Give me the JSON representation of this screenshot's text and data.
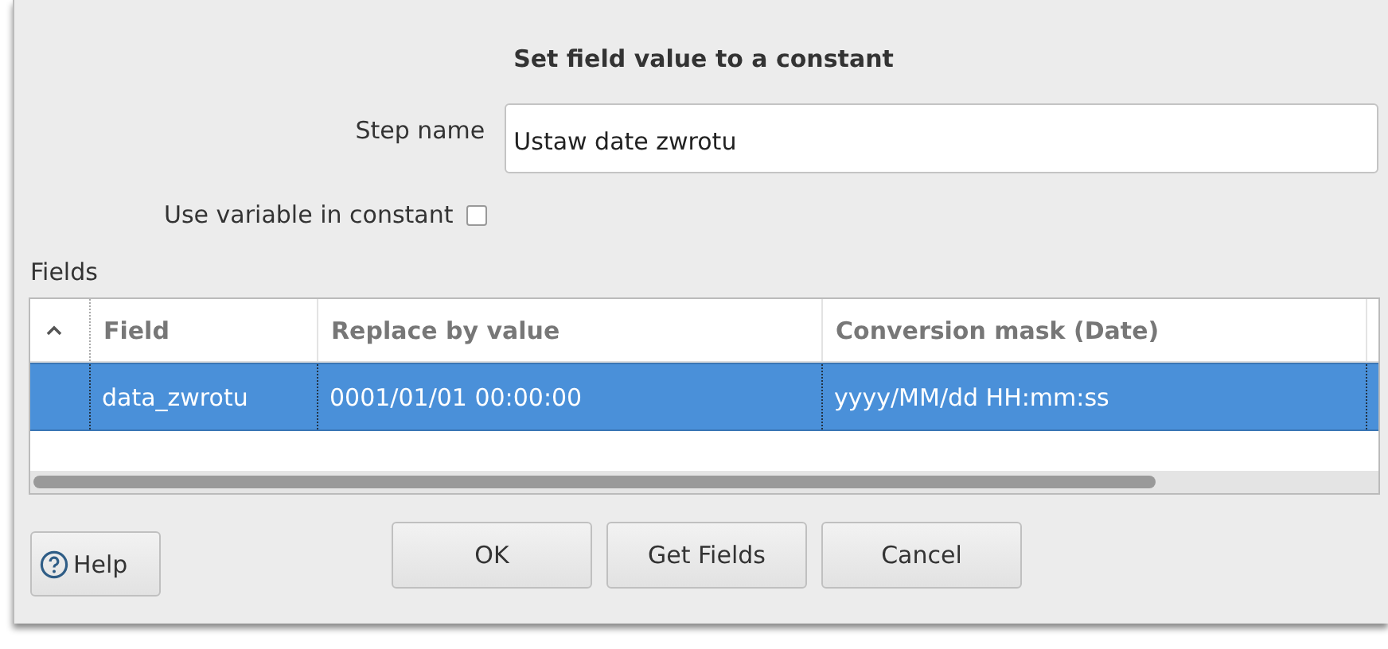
{
  "dialog": {
    "title": "Set field value to a constant"
  },
  "step_name": {
    "label": "Step name",
    "value": "Ustaw date zwrotu"
  },
  "use_variable": {
    "label": "Use variable in constant",
    "checked": false
  },
  "fields": {
    "label": "Fields",
    "columns": [
      "Field",
      "Replace by value",
      "Conversion mask (Date)"
    ],
    "rows": [
      {
        "selected": true,
        "cells": [
          "data_zwrotu",
          "0001/01/01 00:00:00",
          "yyyy/MM/dd HH:mm:ss"
        ]
      }
    ]
  },
  "help_button": "Help",
  "buttons": [
    "OK",
    "Get Fields",
    "Cancel"
  ]
}
